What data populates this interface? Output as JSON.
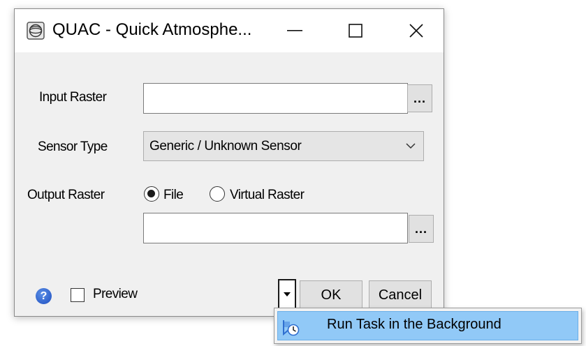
{
  "window": {
    "title": "QUAC - Quick Atmosphe...",
    "app_icon": "globe-icon",
    "controls": [
      "minimize-icon",
      "maximize-icon",
      "close-icon"
    ]
  },
  "form": {
    "input_raster": {
      "label": "Input Raster",
      "value": "",
      "browse_label": "..."
    },
    "sensor_type": {
      "label": "Sensor Type",
      "selected": "Generic / Unknown Sensor"
    },
    "output_raster": {
      "label": "Output Raster",
      "options": [
        {
          "label": "File",
          "selected": true
        },
        {
          "label": "Virtual Raster",
          "selected": false
        }
      ],
      "value": "",
      "browse_label": "..."
    }
  },
  "footer": {
    "help_icon": "help-icon",
    "preview": {
      "label": "Preview",
      "checked": false
    },
    "ok_label": "OK",
    "cancel_label": "Cancel"
  },
  "popup_menu": {
    "items": [
      {
        "label": "Run Task in the Background",
        "icon": "background-task-icon",
        "highlighted": true
      }
    ]
  },
  "colors": {
    "dialog_bg": "#f0f0f0",
    "menu_highlight": "#91c9f7",
    "help_blue": "#1e4fc0"
  }
}
